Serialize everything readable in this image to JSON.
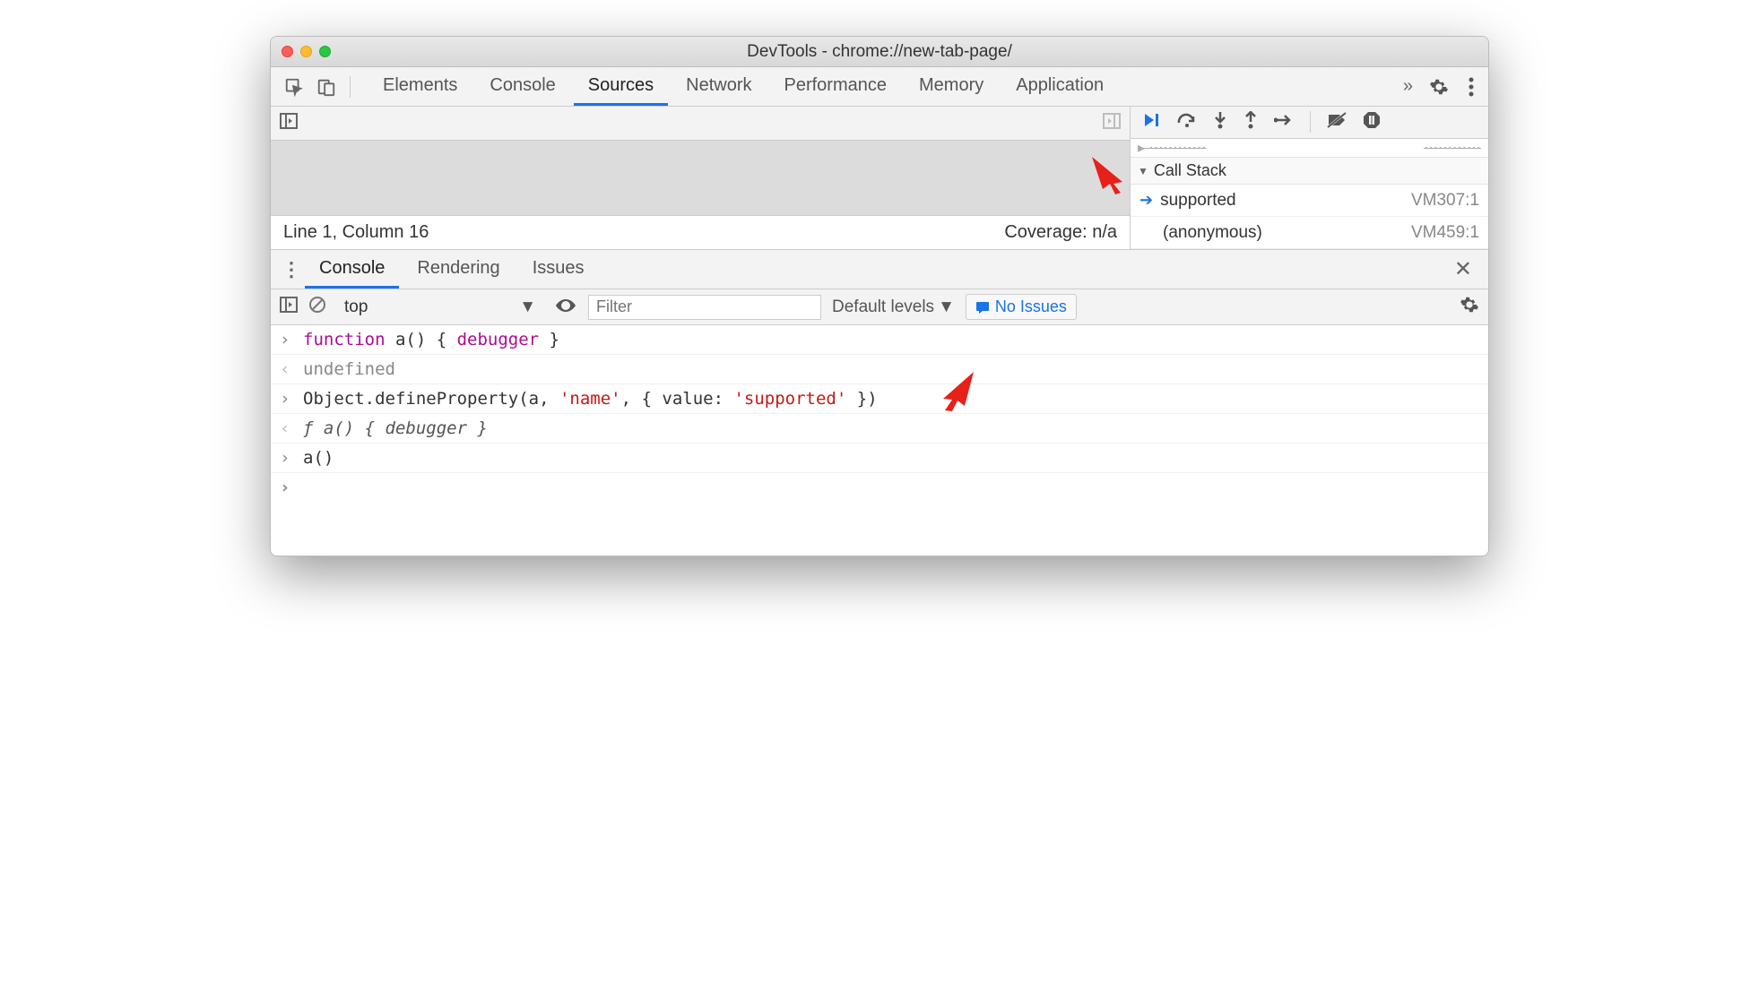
{
  "window": {
    "title": "DevTools - chrome://new-tab-page/"
  },
  "tabs": {
    "items": [
      "Elements",
      "Console",
      "Sources",
      "Network",
      "Performance",
      "Memory",
      "Application"
    ],
    "active": "Sources",
    "more": "»"
  },
  "source": {
    "status_left": "Line 1, Column 16",
    "status_right": "Coverage: n/a"
  },
  "debugger": {
    "call_stack_label": "Call Stack",
    "frames": [
      {
        "name": "supported",
        "loc": "VM307:1",
        "current": true
      },
      {
        "name": "(anonymous)",
        "loc": "VM459:1",
        "current": false
      }
    ]
  },
  "drawer": {
    "tabs": [
      "Console",
      "Rendering",
      "Issues"
    ],
    "active": "Console"
  },
  "console_toolbar": {
    "context": "top",
    "filter_placeholder": "Filter",
    "levels": "Default levels",
    "issues": "No Issues"
  },
  "console_lines": {
    "l0_kw1": "function",
    "l0_mid": " a() { ",
    "l0_kw2": "debugger",
    "l0_end": " }",
    "l1": "undefined",
    "l2_pre": "Object.defineProperty(a, ",
    "l2_s1": "'name'",
    "l2_mid": ", { value: ",
    "l2_s2": "'supported'",
    "l2_end": " })",
    "l3": "ƒ a() { debugger }",
    "l4": "a()"
  }
}
